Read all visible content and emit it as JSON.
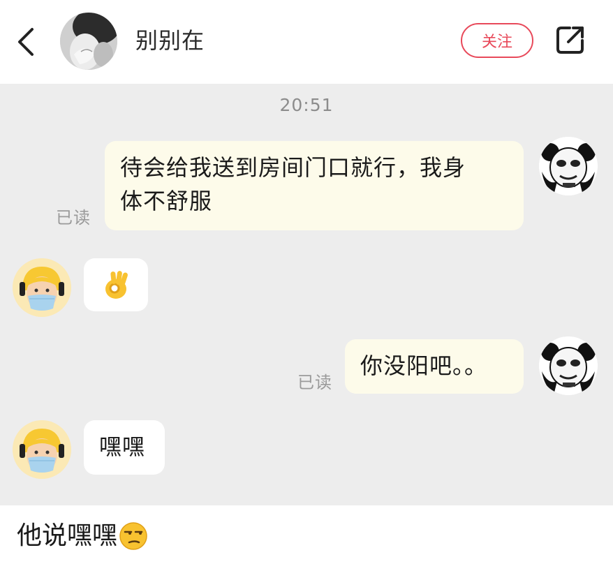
{
  "header": {
    "contact_name": "别别在",
    "follow_label": "关注",
    "icons": {
      "back": "chevron-left-icon",
      "share": "share-icon"
    }
  },
  "chat": {
    "timestamp": "20:51",
    "messages": [
      {
        "direction": "outgoing",
        "lines": [
          "待会给我送到房间门口就行，我身",
          "体不舒服"
        ],
        "read_status": "已读"
      },
      {
        "direction": "incoming",
        "emoji": "ok-hand-emoji"
      },
      {
        "direction": "outgoing",
        "text": "你没阳吧。。",
        "read_status": "已读"
      },
      {
        "direction": "incoming",
        "text": "嘿嘿"
      }
    ]
  },
  "caption": {
    "text": "他说嘿嘿",
    "emoji": "unamused-face-emoji"
  },
  "colors": {
    "accent": "#e8495a",
    "chat_background": "#ededed",
    "outgoing_bubble": "#fdfbea",
    "incoming_bubble": "#ffffff"
  }
}
